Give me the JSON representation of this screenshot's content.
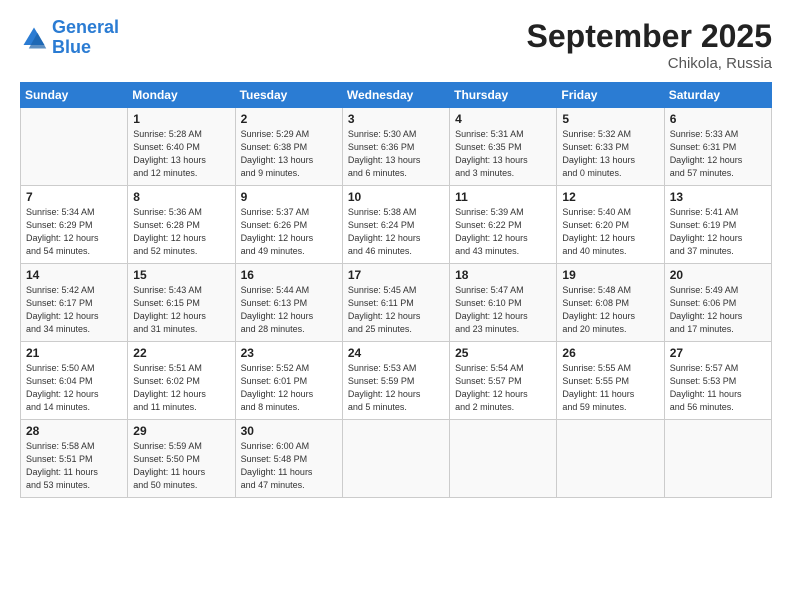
{
  "header": {
    "logo_line1": "General",
    "logo_line2": "Blue",
    "month_title": "September 2025",
    "location": "Chikola, Russia"
  },
  "days_of_week": [
    "Sunday",
    "Monday",
    "Tuesday",
    "Wednesday",
    "Thursday",
    "Friday",
    "Saturday"
  ],
  "weeks": [
    [
      {
        "day": "",
        "lines": []
      },
      {
        "day": "1",
        "lines": [
          "Sunrise: 5:28 AM",
          "Sunset: 6:40 PM",
          "Daylight: 13 hours",
          "and 12 minutes."
        ]
      },
      {
        "day": "2",
        "lines": [
          "Sunrise: 5:29 AM",
          "Sunset: 6:38 PM",
          "Daylight: 13 hours",
          "and 9 minutes."
        ]
      },
      {
        "day": "3",
        "lines": [
          "Sunrise: 5:30 AM",
          "Sunset: 6:36 PM",
          "Daylight: 13 hours",
          "and 6 minutes."
        ]
      },
      {
        "day": "4",
        "lines": [
          "Sunrise: 5:31 AM",
          "Sunset: 6:35 PM",
          "Daylight: 13 hours",
          "and 3 minutes."
        ]
      },
      {
        "day": "5",
        "lines": [
          "Sunrise: 5:32 AM",
          "Sunset: 6:33 PM",
          "Daylight: 13 hours",
          "and 0 minutes."
        ]
      },
      {
        "day": "6",
        "lines": [
          "Sunrise: 5:33 AM",
          "Sunset: 6:31 PM",
          "Daylight: 12 hours",
          "and 57 minutes."
        ]
      }
    ],
    [
      {
        "day": "7",
        "lines": [
          "Sunrise: 5:34 AM",
          "Sunset: 6:29 PM",
          "Daylight: 12 hours",
          "and 54 minutes."
        ]
      },
      {
        "day": "8",
        "lines": [
          "Sunrise: 5:36 AM",
          "Sunset: 6:28 PM",
          "Daylight: 12 hours",
          "and 52 minutes."
        ]
      },
      {
        "day": "9",
        "lines": [
          "Sunrise: 5:37 AM",
          "Sunset: 6:26 PM",
          "Daylight: 12 hours",
          "and 49 minutes."
        ]
      },
      {
        "day": "10",
        "lines": [
          "Sunrise: 5:38 AM",
          "Sunset: 6:24 PM",
          "Daylight: 12 hours",
          "and 46 minutes."
        ]
      },
      {
        "day": "11",
        "lines": [
          "Sunrise: 5:39 AM",
          "Sunset: 6:22 PM",
          "Daylight: 12 hours",
          "and 43 minutes."
        ]
      },
      {
        "day": "12",
        "lines": [
          "Sunrise: 5:40 AM",
          "Sunset: 6:20 PM",
          "Daylight: 12 hours",
          "and 40 minutes."
        ]
      },
      {
        "day": "13",
        "lines": [
          "Sunrise: 5:41 AM",
          "Sunset: 6:19 PM",
          "Daylight: 12 hours",
          "and 37 minutes."
        ]
      }
    ],
    [
      {
        "day": "14",
        "lines": [
          "Sunrise: 5:42 AM",
          "Sunset: 6:17 PM",
          "Daylight: 12 hours",
          "and 34 minutes."
        ]
      },
      {
        "day": "15",
        "lines": [
          "Sunrise: 5:43 AM",
          "Sunset: 6:15 PM",
          "Daylight: 12 hours",
          "and 31 minutes."
        ]
      },
      {
        "day": "16",
        "lines": [
          "Sunrise: 5:44 AM",
          "Sunset: 6:13 PM",
          "Daylight: 12 hours",
          "and 28 minutes."
        ]
      },
      {
        "day": "17",
        "lines": [
          "Sunrise: 5:45 AM",
          "Sunset: 6:11 PM",
          "Daylight: 12 hours",
          "and 25 minutes."
        ]
      },
      {
        "day": "18",
        "lines": [
          "Sunrise: 5:47 AM",
          "Sunset: 6:10 PM",
          "Daylight: 12 hours",
          "and 23 minutes."
        ]
      },
      {
        "day": "19",
        "lines": [
          "Sunrise: 5:48 AM",
          "Sunset: 6:08 PM",
          "Daylight: 12 hours",
          "and 20 minutes."
        ]
      },
      {
        "day": "20",
        "lines": [
          "Sunrise: 5:49 AM",
          "Sunset: 6:06 PM",
          "Daylight: 12 hours",
          "and 17 minutes."
        ]
      }
    ],
    [
      {
        "day": "21",
        "lines": [
          "Sunrise: 5:50 AM",
          "Sunset: 6:04 PM",
          "Daylight: 12 hours",
          "and 14 minutes."
        ]
      },
      {
        "day": "22",
        "lines": [
          "Sunrise: 5:51 AM",
          "Sunset: 6:02 PM",
          "Daylight: 12 hours",
          "and 11 minutes."
        ]
      },
      {
        "day": "23",
        "lines": [
          "Sunrise: 5:52 AM",
          "Sunset: 6:01 PM",
          "Daylight: 12 hours",
          "and 8 minutes."
        ]
      },
      {
        "day": "24",
        "lines": [
          "Sunrise: 5:53 AM",
          "Sunset: 5:59 PM",
          "Daylight: 12 hours",
          "and 5 minutes."
        ]
      },
      {
        "day": "25",
        "lines": [
          "Sunrise: 5:54 AM",
          "Sunset: 5:57 PM",
          "Daylight: 12 hours",
          "and 2 minutes."
        ]
      },
      {
        "day": "26",
        "lines": [
          "Sunrise: 5:55 AM",
          "Sunset: 5:55 PM",
          "Daylight: 11 hours",
          "and 59 minutes."
        ]
      },
      {
        "day": "27",
        "lines": [
          "Sunrise: 5:57 AM",
          "Sunset: 5:53 PM",
          "Daylight: 11 hours",
          "and 56 minutes."
        ]
      }
    ],
    [
      {
        "day": "28",
        "lines": [
          "Sunrise: 5:58 AM",
          "Sunset: 5:51 PM",
          "Daylight: 11 hours",
          "and 53 minutes."
        ]
      },
      {
        "day": "29",
        "lines": [
          "Sunrise: 5:59 AM",
          "Sunset: 5:50 PM",
          "Daylight: 11 hours",
          "and 50 minutes."
        ]
      },
      {
        "day": "30",
        "lines": [
          "Sunrise: 6:00 AM",
          "Sunset: 5:48 PM",
          "Daylight: 11 hours",
          "and 47 minutes."
        ]
      },
      {
        "day": "",
        "lines": []
      },
      {
        "day": "",
        "lines": []
      },
      {
        "day": "",
        "lines": []
      },
      {
        "day": "",
        "lines": []
      }
    ]
  ]
}
